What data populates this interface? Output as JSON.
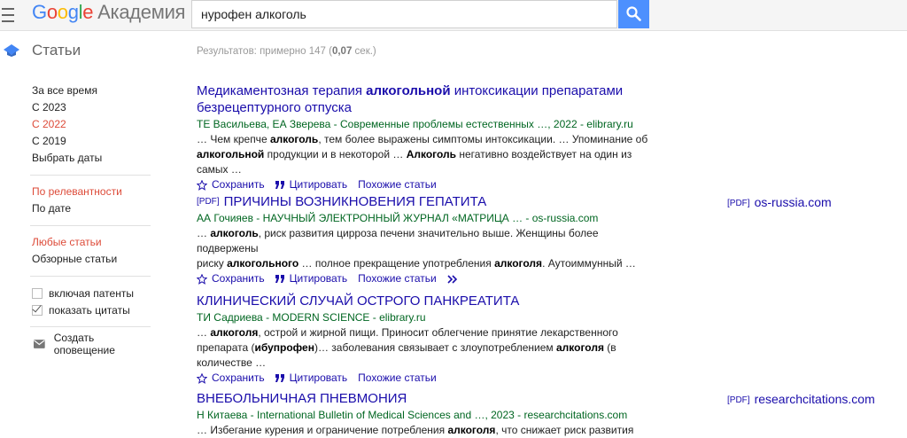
{
  "header": {
    "logo_google": "Google",
    "logo_sub": "Академия",
    "search_value": "нурофен алкоголь"
  },
  "subbar": {
    "section_title": "Статьи",
    "stats_prefix": "Результатов: примерно 147 (",
    "stats_time": "0,07",
    "stats_suffix": " сек.)"
  },
  "sidebar": {
    "time": [
      "За все время",
      "С 2023",
      "С 2022",
      "С 2019",
      "Выбрать даты"
    ],
    "sort": [
      "По релевантности",
      "По дате"
    ],
    "types": [
      "Любые статьи",
      "Обзорные статьи"
    ],
    "include_patents": "включая патенты",
    "show_citations": "показать цитаты",
    "create_alert": "Создать оповещение"
  },
  "actions": {
    "save": "Сохранить",
    "cite": "Цитировать",
    "related": "Похожие статьи"
  },
  "results": [
    {
      "title_a": "Медикаментозная терапия ",
      "title_b": "алкогольной",
      "title_c": " интоксикации препаратами безрецептурного отпуска",
      "meta": "ТЕ Васильева, ЕА Зверева - Современные проблемы естественных …, 2022 - elibrary.ru",
      "s1a": "… Чем крепче ",
      "s1b": "алкоголь",
      "s1c": ", тем более выражены симптомы интоксикации. … Упоминание об",
      "s2a": "алкогольной",
      "s2b": " продукции и в некоторой … ",
      "s2c": "Алкоголь",
      "s2d": " негативно воздействует на один из самых …"
    },
    {
      "pdf_tag": "[PDF]",
      "title": "ПРИЧИНЫ ВОЗНИКНОВЕНИЯ ГЕПАТИТА",
      "meta": "АА Гочияев - НАУЧНЫЙ ЭЛЕКТРОННЫЙ ЖУРНАЛ «МАТРИЦА … - os-russia.com",
      "s1a": "… ",
      "s1b": "алкоголь",
      "s1c": ", риск развития цирроза печени значительно выше. Женщины более подвержены",
      "s2a": "риску ",
      "s2b": "алкогольного",
      "s2c": " … полное прекращение употребления ",
      "s2d": "алкоголя",
      "s2e": ". Аутоиммунный …",
      "side_pdf": "[PDF]",
      "side_domain": "os-russia.com"
    },
    {
      "title": "КЛИНИЧЕСКИЙ СЛУЧАЙ ОСТРОГО ПАНКРЕАТИТА",
      "meta": "ТИ Садриева - MODERN SCIENCE - elibrary.ru",
      "s1a": "… ",
      "s1b": "алкоголя",
      "s1c": ", острой и жирной пищи. Приносит облегчение принятие лекарственного",
      "s2a": "препарата (",
      "s2b": "ибупрофен",
      "s2c": ")… заболевания связывает с злоупотреблением ",
      "s2d": "алкоголя",
      "s2e": " (в количестве …"
    },
    {
      "title": "ВНЕБОЛЬНИЧНАЯ ПНЕВМОНИЯ",
      "meta": "Н Китаева - International Bulletin of Medical Sciences and …, 2023 - researchcitations.com",
      "s1a": "… Избегание курения и ограничение потребления ",
      "s1b": "алкоголя",
      "s1c": ", что снижает риск развития",
      "side_pdf": "[PDF]",
      "side_domain": "researchcitations.com"
    }
  ]
}
